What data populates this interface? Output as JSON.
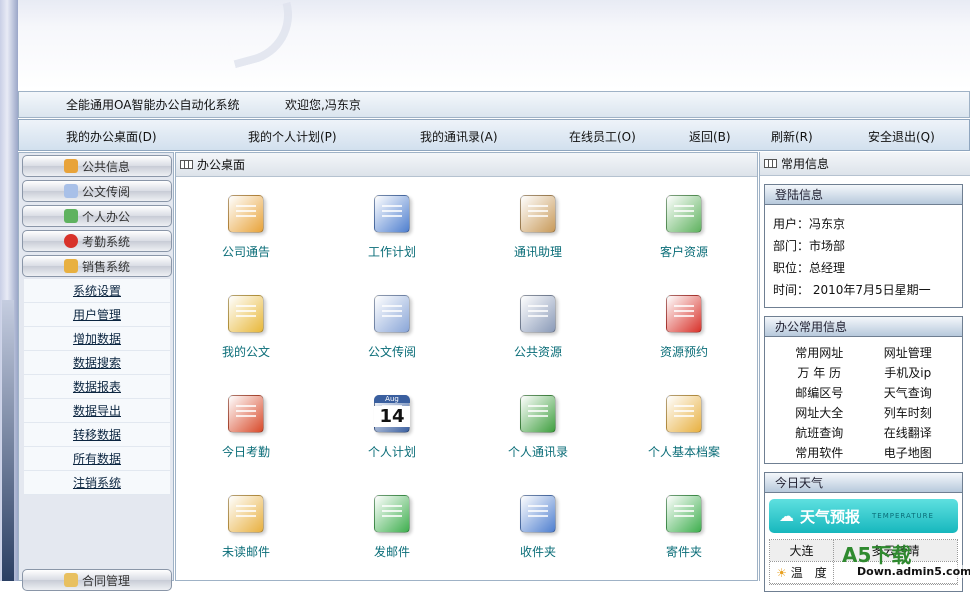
{
  "header": {
    "title": "全能通用OA智能办公自动化系统",
    "welcome": "欢迎您,冯东京"
  },
  "nav": [
    "我的办公桌面(D)",
    "我的个人计划(P)",
    "我的通讯录(A)",
    "在线员工(O)",
    "返回(B)",
    "刷新(R)",
    "安全退出(Q)"
  ],
  "sidebar": {
    "buttons": [
      "公共信息",
      "公文传阅",
      "个人办公",
      "考勤系统",
      "销售系统"
    ],
    "sub_items": [
      "系统设置",
      "用户管理",
      "增加数据",
      "数据搜索",
      "数据报表",
      "数据导出",
      "转移数据",
      "所有数据",
      "注销系统"
    ],
    "bottom_button": "合同管理"
  },
  "main": {
    "title": "办公桌面",
    "items": [
      {
        "label": "公司通告",
        "icon": "clipboard-icon",
        "color": "#e8a33a"
      },
      {
        "label": "工作计划",
        "icon": "calendar-icon",
        "color": "#4f7fcf"
      },
      {
        "label": "通讯助理",
        "icon": "address-book-icon",
        "color": "#c89a5a"
      },
      {
        "label": "客户资源",
        "icon": "contact-card-icon",
        "color": "#5fb25f"
      },
      {
        "label": "我的公文",
        "icon": "folder-pen-icon",
        "color": "#e8b83a"
      },
      {
        "label": "公文传阅",
        "icon": "documents-icon",
        "color": "#8aa6d8"
      },
      {
        "label": "公共资源",
        "icon": "printer-icon",
        "color": "#8a9ab8"
      },
      {
        "label": "资源预约",
        "icon": "car-icon",
        "color": "#d8322a"
      },
      {
        "label": "今日考勤",
        "icon": "calendar-clock-icon",
        "color": "#d84a2a"
      },
      {
        "label": "个人计划",
        "icon": "date-14-icon",
        "color": "#3a5f9f",
        "text": "14",
        "month": "Aug"
      },
      {
        "label": "个人通讯录",
        "icon": "person-book-icon",
        "color": "#3f9f3f"
      },
      {
        "label": "个人基本档案",
        "icon": "profile-envelope-icon",
        "color": "#e8b040"
      },
      {
        "label": "未读邮件",
        "icon": "mail-clock-icon",
        "color": "#e8b040"
      },
      {
        "label": "发邮件",
        "icon": "send-mail-icon",
        "color": "#3faf4f"
      },
      {
        "label": "收件夹",
        "icon": "inbox-icon",
        "color": "#4f7fcf"
      },
      {
        "label": "寄件夹",
        "icon": "outbox-icon",
        "color": "#3faf4f"
      }
    ]
  },
  "right": {
    "title": "常用信息",
    "login": {
      "title": "登陆信息",
      "rows": [
        "用户：冯东京",
        "部门：市场部",
        "职位：总经理",
        "时间： 2010年7月5日星期一"
      ]
    },
    "office": {
      "title": "办公常用信息",
      "links": [
        "常用网址",
        "网址管理",
        "万 年 历",
        "手机及ip",
        "邮编区号",
        "天气查询",
        "网址大全",
        "列车时刻",
        "航班查询",
        "在线翻译",
        "常用软件",
        "电子地图"
      ]
    },
    "weather": {
      "title": "今日天气",
      "banner": "天气预报",
      "banner_sub": "TEMPERATURE",
      "city": "大连",
      "condition": "多云转晴",
      "temp_label": "温　度"
    }
  },
  "watermark": {
    "brand": "A5下载",
    "url": "Down.admin5.com"
  }
}
